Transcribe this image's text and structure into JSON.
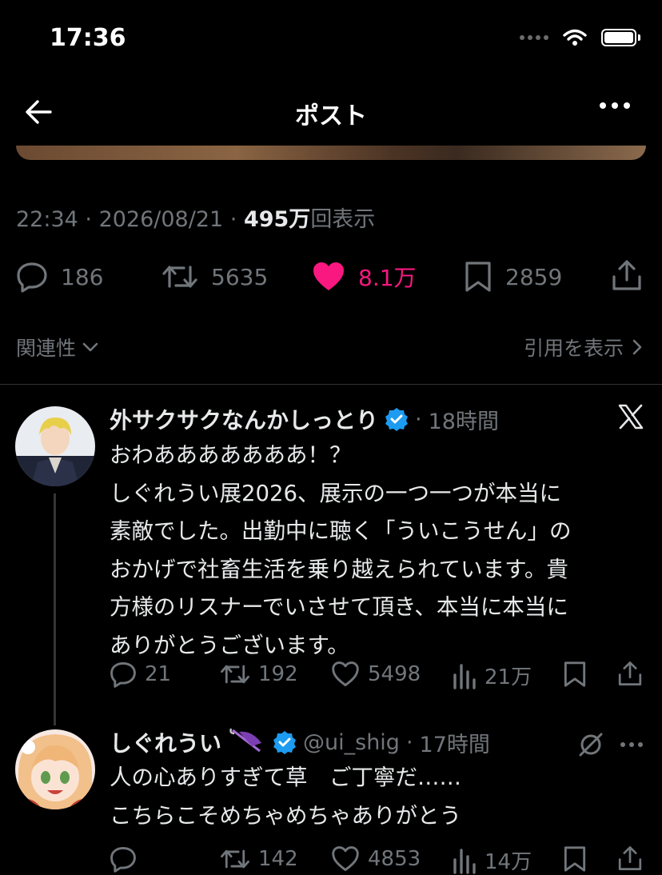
{
  "status_bar": {
    "time": "17:36"
  },
  "header": {
    "title": "ポスト"
  },
  "post": {
    "time": "22:34",
    "date": "2026/08/21",
    "views_count": "495万",
    "views_label": "回表示",
    "stats": {
      "replies": "186",
      "reposts": "5635",
      "likes": "8.1万",
      "bookmarks": "2859"
    },
    "liked": true
  },
  "sort": {
    "label": "関連性"
  },
  "quotes_link": {
    "label": "引用を表示"
  },
  "replies": [
    {
      "name": "外サクサクなんかしっとり",
      "verified": true,
      "time": "18時間",
      "lines": [
        "おわあああああああ！？",
        "しぐれうい展2026、展示の一つ一つが本当に",
        "素敵でした。出勤中に聴く「ういこうせん」の",
        "おかげで社畜生活を乗り越えられています。貴",
        "方様のリスナーでいさせて頂き、本当に本当に",
        "ありがとうございます。"
      ],
      "stats": {
        "replies": "21",
        "reposts": "192",
        "likes": "5498",
        "views": "21万"
      }
    },
    {
      "name": "しぐれうい",
      "verified": true,
      "handle": "@ui_shig",
      "time": "17時間",
      "lines": [
        "人の心ありすぎて草　ご丁寧だ……",
        "こちらこそめちゃめちゃありがとう"
      ],
      "stats": {
        "replies": "",
        "reposts": "142",
        "likes": "4853",
        "views": "14万"
      }
    }
  ],
  "colors": {
    "like_pink": "#f91880",
    "verified_blue": "#1d9bf0",
    "muted": "#71767b"
  }
}
